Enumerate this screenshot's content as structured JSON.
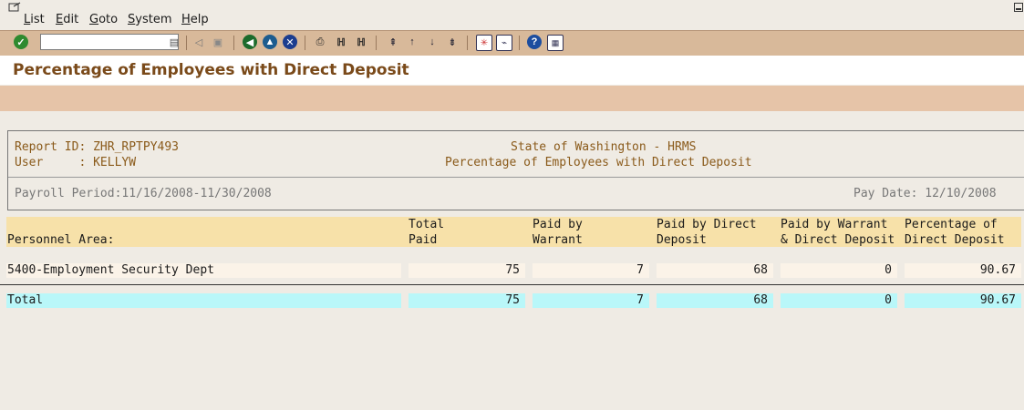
{
  "menu": {
    "items": [
      "List",
      "Edit",
      "Goto",
      "System",
      "Help"
    ]
  },
  "toolbar": {
    "command_value": "",
    "icons": [
      "enter-icon",
      "back-icon",
      "save-icon",
      "back-nav-icon",
      "exit-icon",
      "cancel-icon",
      "print-icon",
      "find-icon",
      "find-next-icon",
      "first-page-icon",
      "prev-page-icon",
      "next-page-icon",
      "last-page-icon",
      "new-session-icon",
      "shortcut-icon",
      "help-icon",
      "customize-icon"
    ]
  },
  "title": "Percentage of Employees with Direct Deposit",
  "report": {
    "id_line": "Report ID: ZHR_RPTPY493",
    "user_line": "User     : KELLYW",
    "org": "State of Washington - HRMS",
    "subtitle": "Percentage of Employees with Direct Deposit",
    "payroll_period": "Payroll Period:11/16/2008-11/30/2008",
    "pay_date": "Pay Date: 12/10/2008"
  },
  "table": {
    "columns": [
      {
        "l1": "",
        "l2": "Personnel Area:"
      },
      {
        "l1": "Total",
        "l2": "Paid"
      },
      {
        "l1": "Paid by",
        "l2": "Warrant"
      },
      {
        "l1": "Paid by Direct",
        "l2": "Deposit"
      },
      {
        "l1": "Paid by Warrant",
        "l2": "& Direct Deposit"
      },
      {
        "l1": "Percentage of",
        "l2": "Direct Deposit"
      }
    ],
    "rows": [
      {
        "area": "5400-Employment Security Dept",
        "total": "75",
        "warrant": "7",
        "direct": "68",
        "both": "0",
        "pct": "90.67"
      }
    ],
    "total": {
      "area": "Total",
      "total": "75",
      "warrant": "7",
      "direct": "68",
      "both": "0",
      "pct": "90.67"
    }
  },
  "colors": {
    "toolbar": "#d8b99a",
    "title_text": "#7a4a1a",
    "header_fill": "#f7e1a9",
    "total_fill": "#b9f7f9"
  }
}
